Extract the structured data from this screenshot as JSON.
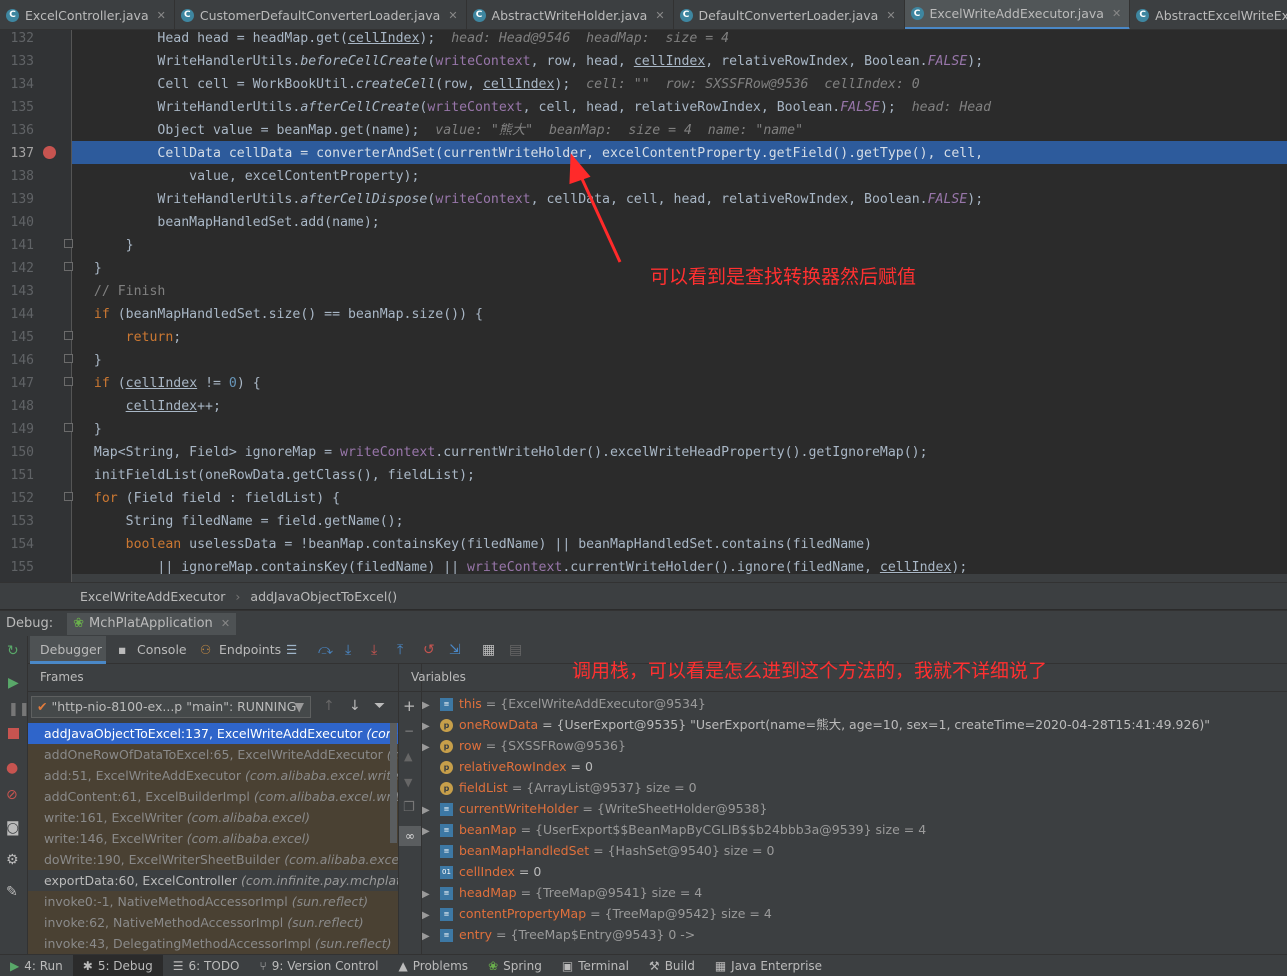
{
  "tabs": [
    {
      "label": "ExcelController.java",
      "active": false
    },
    {
      "label": "CustomerDefaultConverterLoader.java",
      "active": false
    },
    {
      "label": "AbstractWriteHolder.java",
      "active": false
    },
    {
      "label": "DefaultConverterLoader.java",
      "active": false
    },
    {
      "label": "ExcelWriteAddExecutor.java",
      "active": true
    },
    {
      "label": "AbstractExcelWriteExecutor.java",
      "active": false
    }
  ],
  "line_numbers": [
    "132",
    "133",
    "134",
    "135",
    "136",
    "137",
    "138",
    "139",
    "140",
    "141",
    "142",
    "143",
    "144",
    "145",
    "146",
    "147",
    "148",
    "149",
    "150",
    "151",
    "152",
    "153",
    "154",
    "155"
  ],
  "annotations": {
    "editor_note": "可以看到是查找转换器然后赋值",
    "debug_note": "调用栈，可以看是怎么进到这个方法的，我就不详细说了"
  },
  "breadcrumb": {
    "class": "ExcelWriteAddExecutor",
    "method": "addJavaObjectToExcel()"
  },
  "debug": {
    "label": "Debug:",
    "config": "MchPlatApplication",
    "tabs": {
      "debugger": "Debugger",
      "console": "Console",
      "endpoints": "Endpoints"
    },
    "frames_header": "Frames",
    "variables_header": "Variables",
    "thread": "\"http-nio-8100-ex...p \"main\": RUNNING"
  },
  "frames": [
    {
      "method": "addJavaObjectToExcel:137, ExcelWriteAddExecutor",
      "pkg": "(com.alib",
      "state": "sel"
    },
    {
      "method": "addOneRowOfDataToExcel:65, ExcelWriteAddExecutor",
      "pkg": "(com.",
      "state": "lib"
    },
    {
      "method": "add:51, ExcelWriteAddExecutor",
      "pkg": "(com.alibaba.excel.write.exec",
      "state": "lib"
    },
    {
      "method": "addContent:61, ExcelBuilderImpl",
      "pkg": "(com.alibaba.excel.write)",
      "state": "lib"
    },
    {
      "method": "write:161, ExcelWriter",
      "pkg": "(com.alibaba.excel)",
      "state": "lib"
    },
    {
      "method": "write:146, ExcelWriter",
      "pkg": "(com.alibaba.excel)",
      "state": "lib"
    },
    {
      "method": "doWrite:190, ExcelWriterSheetBuilder",
      "pkg": "(com.alibaba.excel.writ",
      "state": "lib"
    },
    {
      "method": "exportData:60, ExcelController",
      "pkg": "(com.infinite.pay.mchplat.mod",
      "state": "normal"
    },
    {
      "method": "invoke0:-1, NativeMethodAccessorImpl",
      "pkg": "(sun.reflect)",
      "state": "lib"
    },
    {
      "method": "invoke:62, NativeMethodAccessorImpl",
      "pkg": "(sun.reflect)",
      "state": "lib"
    },
    {
      "method": "invoke:43, DelegatingMethodAccessorImpl",
      "pkg": "(sun.reflect)",
      "state": "lib"
    }
  ],
  "variables": [
    {
      "name": "this",
      "value": "= {ExcelWriteAddExecutor@9534}",
      "expand": true,
      "icon": "list"
    },
    {
      "name": "oneRowData",
      "value": "= {UserExport@9535} \"UserExport(name=熊大, age=10, sex=1, createTime=2020-04-28T15:41:49.926)\"",
      "expand": true,
      "icon": "p"
    },
    {
      "name": "row",
      "value": "= {SXSSFRow@9536}",
      "expand": true,
      "icon": "p"
    },
    {
      "name": "relativeRowIndex",
      "value": "= 0",
      "expand": false,
      "icon": "p"
    },
    {
      "name": "fieldList",
      "value": "= {ArrayList@9537}  size = 0",
      "expand": false,
      "icon": "p"
    },
    {
      "name": "currentWriteHolder",
      "value": "= {WriteSheetHolder@9538}",
      "expand": true,
      "icon": "list"
    },
    {
      "name": "beanMap",
      "value": "= {UserExport$$BeanMapByCGLIB$$b24bbb3a@9539}  size = 4",
      "expand": true,
      "icon": "list"
    },
    {
      "name": "beanMapHandledSet",
      "value": "= {HashSet@9540}  size = 0",
      "expand": false,
      "icon": "list"
    },
    {
      "name": "cellIndex",
      "value": "= 0",
      "expand": false,
      "icon": "01"
    },
    {
      "name": "headMap",
      "value": "= {TreeMap@9541}  size = 4",
      "expand": true,
      "icon": "list"
    },
    {
      "name": "contentPropertyMap",
      "value": "= {TreeMap@9542}  size = 4",
      "expand": true,
      "icon": "list"
    },
    {
      "name": "entry",
      "value": "= {TreeMap$Entry@9543} 0 ->",
      "expand": true,
      "icon": "list"
    }
  ],
  "statusbar": [
    {
      "label": "4: Run",
      "active": false
    },
    {
      "label": "5: Debug",
      "active": true
    },
    {
      "label": "6: TODO",
      "active": false
    },
    {
      "label": "9: Version Control",
      "active": false
    },
    {
      "label": "Problems",
      "active": false
    },
    {
      "label": "Spring",
      "active": false
    },
    {
      "label": "Terminal",
      "active": false
    },
    {
      "label": "Build",
      "active": false
    },
    {
      "label": "Java Enterprise",
      "active": false
    }
  ],
  "colors": {
    "accent": "#2d5b9c",
    "annotation": "#ff3030",
    "selected_frame": "#2f65ca"
  }
}
